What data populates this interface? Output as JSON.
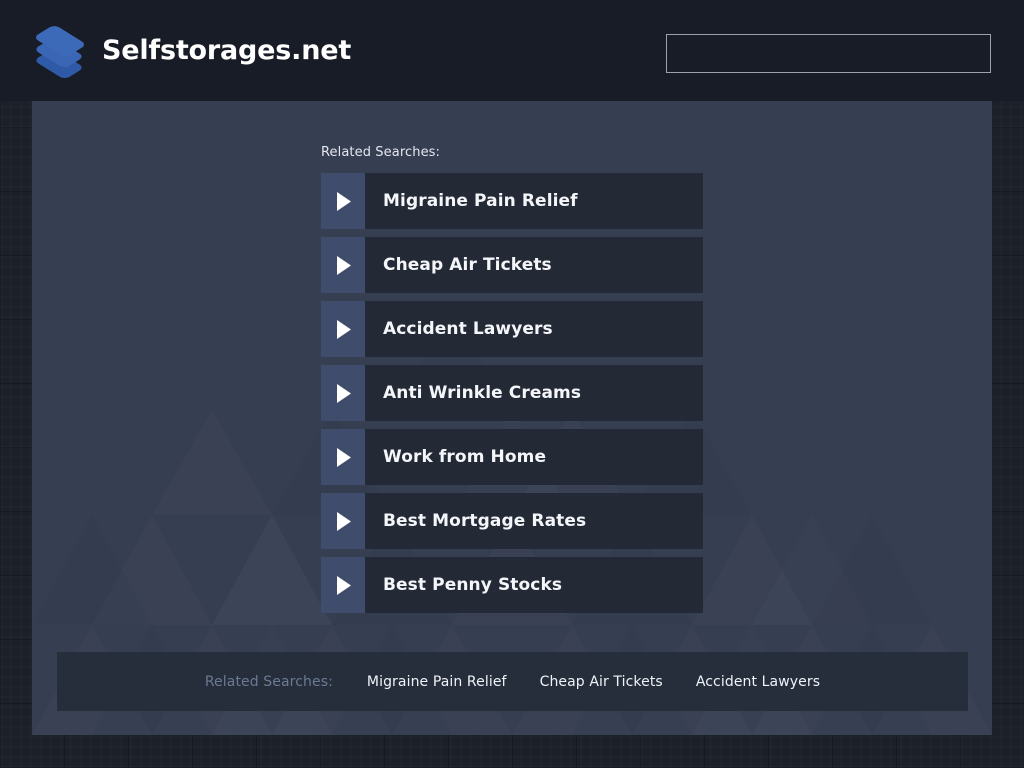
{
  "header": {
    "brand_name": "Selfstorages.net",
    "logo_icon": "stacked-layers-icon",
    "search": {
      "value": "",
      "placeholder": ""
    }
  },
  "main": {
    "related_heading": "Related Searches:",
    "arrow_icon": "play-triangle-icon",
    "items": [
      {
        "label": "Migraine Pain Relief"
      },
      {
        "label": "Cheap Air Tickets"
      },
      {
        "label": "Accident Lawyers"
      },
      {
        "label": "Anti Wrinkle Creams"
      },
      {
        "label": "Work from Home"
      },
      {
        "label": "Best Mortgage Rates"
      },
      {
        "label": "Best Penny Stocks"
      }
    ]
  },
  "footer": {
    "label": "Related Searches:",
    "links": [
      {
        "label": "Migraine Pain Relief"
      },
      {
        "label": "Cheap Air Tickets"
      },
      {
        "label": "Accident Lawyers"
      }
    ]
  },
  "colors": {
    "page_background": "#1b2029",
    "header_background": "#171c26",
    "panel_background": "#363e52",
    "item_arrow_background": "#3f4c6b",
    "item_label_background": "#232a36",
    "footer_background": "#262e3b",
    "footer_label_text": "#6b7a93",
    "text_primary": "#f4f6fa",
    "logo_blue": "#3d6ab8",
    "search_border": "#9aa3ad"
  }
}
